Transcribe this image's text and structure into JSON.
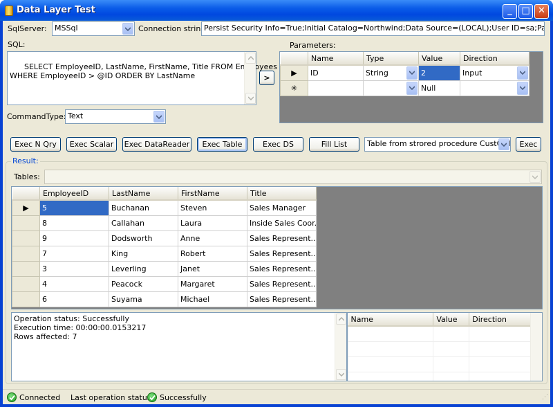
{
  "window": {
    "title": "Data Layer Test"
  },
  "top": {
    "sqlserver_label": "SqlServer:",
    "sqlserver_value": "MSSql",
    "connection_label": "Connection string:",
    "connection_value": "Persist Security Info=True;Initial Catalog=Northwind;Data Source=(LOCAL);User ID=sa;Password=maste"
  },
  "sql": {
    "label": "SQL:",
    "text": "SELECT EmployeeID, LastName, FirstName, Title FROM Employees\nWHERE EmployeeID > @ID ORDER BY LastName",
    "move_button": ">"
  },
  "command_type": {
    "label": "CommandType:",
    "value": "Text"
  },
  "parameters": {
    "label": "Parameters:",
    "columns": [
      "Name",
      "Type",
      "Value",
      "Direction"
    ],
    "rows": [
      {
        "marker": "▶",
        "name": "ID",
        "type": "String",
        "value": "2",
        "direction": "Input"
      },
      {
        "marker": "✳",
        "name": "",
        "type": "",
        "value": "Null",
        "direction": ""
      }
    ]
  },
  "actions": {
    "exec_nqry": "Exec N Qry",
    "exec_scalar": "Exec Scalar",
    "exec_datareader": "Exec DataReader",
    "exec_table": "Exec Table",
    "exec_ds": "Exec DS",
    "fill_list": "Fill List",
    "proc_combo": "Table from strored procedure CustOrderH",
    "exec": "Exec"
  },
  "result": {
    "label": "Result:",
    "tables_label": "Tables:",
    "tables_value": "",
    "columns": [
      "EmployeeID",
      "LastName",
      "FirstName",
      "Title"
    ],
    "rows": [
      [
        "5",
        "Buchanan",
        "Steven",
        "Sales Manager"
      ],
      [
        "8",
        "Callahan",
        "Laura",
        "Inside Sales Coor..."
      ],
      [
        "9",
        "Dodsworth",
        "Anne",
        "Sales Represent..."
      ],
      [
        "7",
        "King",
        "Robert",
        "Sales Represent..."
      ],
      [
        "3",
        "Leverling",
        "Janet",
        "Sales Represent..."
      ],
      [
        "4",
        "Peacock",
        "Margaret",
        "Sales Represent..."
      ],
      [
        "6",
        "Suyama",
        "Michael",
        "Sales Represent..."
      ]
    ]
  },
  "log": {
    "line1": "Operation status: Successfully",
    "line2": "Execution time: 00:00:00.0153217",
    "line3": "Rows affected: 7"
  },
  "outparams": {
    "columns": [
      "Name",
      "Value",
      "Direction"
    ]
  },
  "statusbar": {
    "connected": "Connected",
    "last_label": "Last operation status:",
    "last_value": "Successfully",
    "ok_color": "#1f9a1f"
  }
}
